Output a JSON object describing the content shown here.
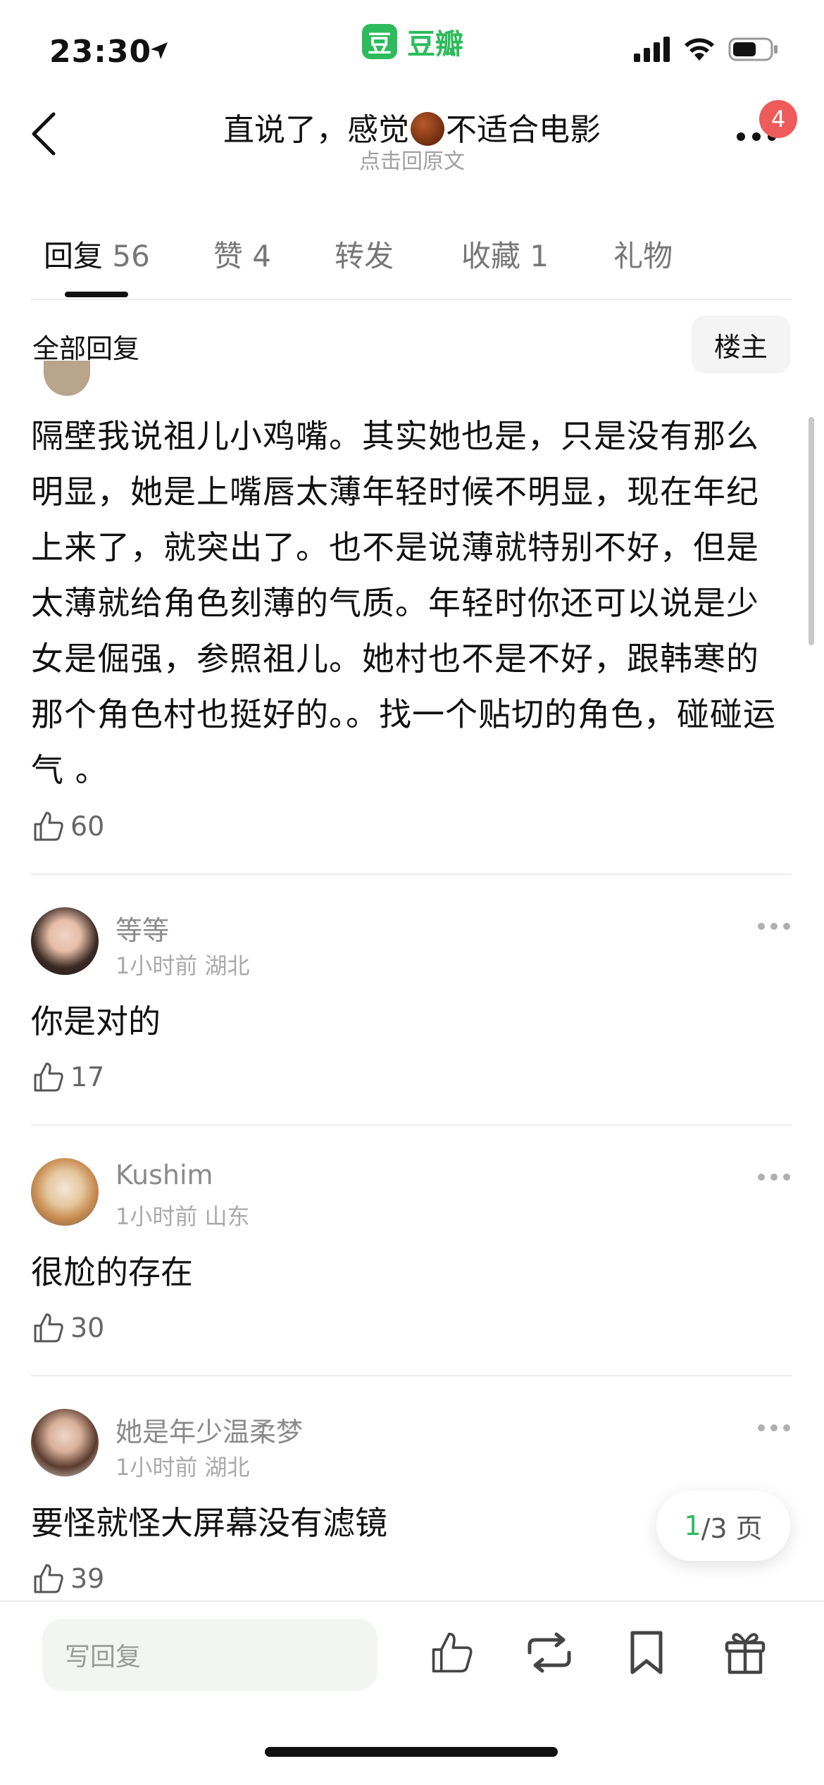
{
  "status_bar": {
    "time": "23:30",
    "location_icon": "location-arrow-icon",
    "signal_icon": "signal-icon",
    "wifi_icon": "wifi-icon",
    "battery_icon": "battery-icon"
  },
  "brand": {
    "logo_text": "豆",
    "name": "豆瓣",
    "color": "#2dbb5d"
  },
  "header": {
    "title_before": "直说了，感觉",
    "title_emoji": "chestnut-emoji",
    "title_after": "不适合电影",
    "subtitle": "点击回原文",
    "notification_count": "4"
  },
  "tabs": [
    {
      "label": "回复",
      "count": "56",
      "active": true
    },
    {
      "label": "赞",
      "count": "4"
    },
    {
      "label": "转发",
      "count": ""
    },
    {
      "label": "收藏",
      "count": "1"
    },
    {
      "label": "礼物",
      "count": ""
    }
  ],
  "filter": {
    "all_label": "全部回复",
    "op_label": "楼主"
  },
  "comments": [
    {
      "text": "隔壁我说祖儿小鸡嘴。其实她也是，只是没有那么明显，她是上嘴唇太薄年轻时候不明显，现在年纪上来了，就突出了。也不是说薄就特别不好，但是太薄就给角色刻薄的气质。年轻时你还可以说是少女是倔强，参照祖儿。她村也不是不好，跟韩寒的那个角色村也挺好的。。找一个贴切的角色，碰碰运气 。",
      "likes": "60"
    },
    {
      "user": "等等",
      "time": "1小时前",
      "region": "湖北",
      "text": "你是对的",
      "likes": "17"
    },
    {
      "user": "Kushim",
      "time": "1小时前",
      "region": "山东",
      "text": "很尬的存在",
      "likes": "30"
    },
    {
      "user": "她是年少温柔梦",
      "time": "1小时前",
      "region": "湖北",
      "text": "要怪就怪大屏幕没有滤镜",
      "likes": "39"
    }
  ],
  "pagination": {
    "current": "1",
    "rest": "/3 页"
  },
  "bottom_bar": {
    "reply_placeholder": "写回复"
  },
  "colors": {
    "accent": "#2dbb5d",
    "badge": "#ee5b5b",
    "text_primary": "#111111",
    "text_secondary": "#8a8a8a"
  }
}
